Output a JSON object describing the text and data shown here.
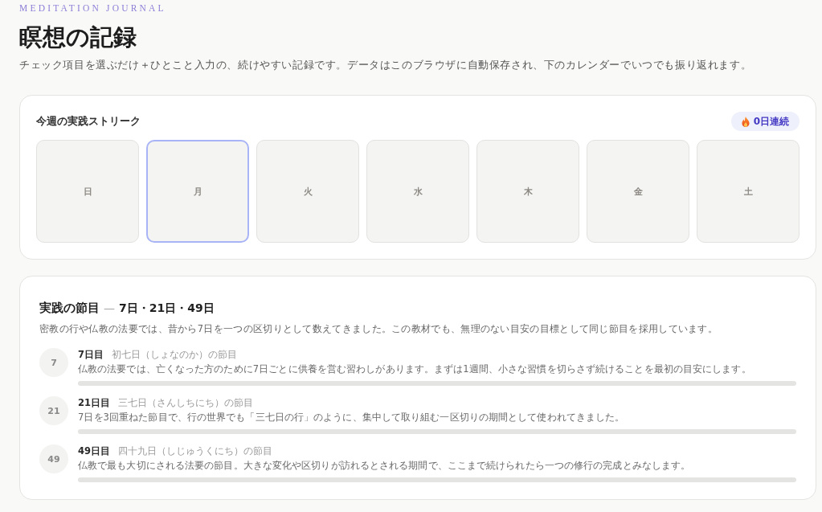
{
  "header": {
    "brand": "MEDITATION JOURNAL",
    "title": "瞑想の記録",
    "intro": "チェック項目を選ぶだけ＋ひとこと入力の、続けやすい記録です。データはこのブラウザに自動保存され、下のカレンダーでいつでも振り返れます。"
  },
  "streak": {
    "title": "今週の実践ストリーク",
    "badge": "0日連続",
    "days": [
      {
        "label": "日",
        "today": false
      },
      {
        "label": "月",
        "today": true
      },
      {
        "label": "火",
        "today": false
      },
      {
        "label": "水",
        "today": false
      },
      {
        "label": "木",
        "today": false
      },
      {
        "label": "金",
        "today": false
      },
      {
        "label": "土",
        "today": false
      }
    ]
  },
  "milestones": {
    "title": "実践の節目",
    "separator": "—",
    "range": "7日・21日・49日",
    "description": "密教の行や仏教の法要では、昔から7日を一つの区切りとして数えてきました。この教材でも、無理のない目安の目標として同じ節目を採用しています。",
    "items": [
      {
        "number": "7",
        "label": "7日目",
        "name": "初七日（しょなのか）の節目",
        "description": "仏教の法要では、亡くなった方のために7日ごとに供養を営む習わしがあります。まずは1週間、小さな習慣を切らさず続けることを最初の目安にします。",
        "level": 0
      },
      {
        "number": "21",
        "label": "21日目",
        "name": "三七日（さんしちにち）の節目",
        "description": "7日を3回重ねた節目で、行の世界でも「三七日の行」のように、集中して取り組む一区切りの期間として使われてきました。",
        "level": 0
      },
      {
        "number": "49",
        "label": "49日目",
        "name": "四十九日（しじゅうくにち）の節目",
        "description": "仏教で最も大切にされる法要の節目。大きな変化や区切りが訪れるとされる期間で、ここまで続けられたら一つの修行の完成とみなします。",
        "level": 0
      }
    ]
  }
}
